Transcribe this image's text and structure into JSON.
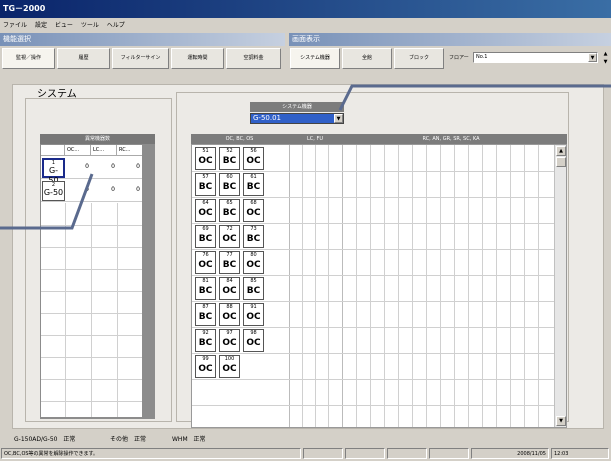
{
  "window": {
    "title": "TG－2000"
  },
  "menu": [
    "ファイル",
    "設定",
    "ビュー",
    "ツール",
    "ヘルプ"
  ],
  "function_select": {
    "header": "機能選択",
    "buttons": [
      "監視／操作",
      "履歴",
      "フィルターサイン",
      "運転時間",
      "空調料金"
    ]
  },
  "screen_display": {
    "header": "画面表示",
    "buttons": [
      "システム機器",
      "全館",
      "ブロック"
    ],
    "floor_label": "フロアー",
    "floor_value": "No.1"
  },
  "system": {
    "title": "システム",
    "abnormal_header": "異常機器数",
    "columns": [
      "OC...",
      "LC...",
      "RC..."
    ],
    "rows": [
      {
        "id": "1",
        "name": "G-50",
        "v1": "0",
        "v2": "0",
        "v3": "0"
      },
      {
        "id": "2",
        "name": "G-50",
        "v1": "0",
        "v2": "0",
        "v3": "0"
      }
    ]
  },
  "system_device": {
    "label": "システム機器",
    "selected": "G-50.01",
    "col_headers": [
      "OC, BC, OS",
      "LC, FU",
      "RC, AN, GR, SR, SC, KA"
    ],
    "devices": [
      [
        {
          "n": "51",
          "t": "OC"
        },
        {
          "n": "52",
          "t": "BC"
        },
        {
          "n": "56",
          "t": "OC"
        }
      ],
      [
        {
          "n": "57",
          "t": "BC"
        },
        {
          "n": "60",
          "t": "BC"
        },
        {
          "n": "61",
          "t": "BC"
        }
      ],
      [
        {
          "n": "64",
          "t": "OC"
        },
        {
          "n": "65",
          "t": "BC"
        },
        {
          "n": "68",
          "t": "OC"
        }
      ],
      [
        {
          "n": "69",
          "t": "BC"
        },
        {
          "n": "72",
          "t": "OC"
        },
        {
          "n": "73",
          "t": "BC"
        }
      ],
      [
        {
          "n": "76",
          "t": "OC"
        },
        {
          "n": "77",
          "t": "BC"
        },
        {
          "n": "80",
          "t": "OC"
        }
      ],
      [
        {
          "n": "81",
          "t": "BC"
        },
        {
          "n": "84",
          "t": "OC"
        },
        {
          "n": "85",
          "t": "BC"
        }
      ],
      [
        {
          "n": "87",
          "t": "BC"
        },
        {
          "n": "88",
          "t": "OC"
        },
        {
          "n": "91",
          "t": "OC"
        }
      ],
      [
        {
          "n": "92",
          "t": "BC"
        },
        {
          "n": "97",
          "t": "OC"
        },
        {
          "n": "98",
          "t": "OC"
        }
      ],
      [
        {
          "n": "99",
          "t": "OC"
        },
        {
          "n": "100",
          "t": "OC"
        }
      ]
    ]
  },
  "bottom_status": {
    "g50_label": "G-150AD/G-50",
    "g50_state": "正常",
    "other_label": "その他",
    "other_state": "正常",
    "whm_label": "WHM",
    "whm_state": "正常"
  },
  "statusbar": {
    "message": "OC,BC,OS等の異常を解除操作できます。",
    "date": "2008/11/05",
    "time": "12:03"
  }
}
